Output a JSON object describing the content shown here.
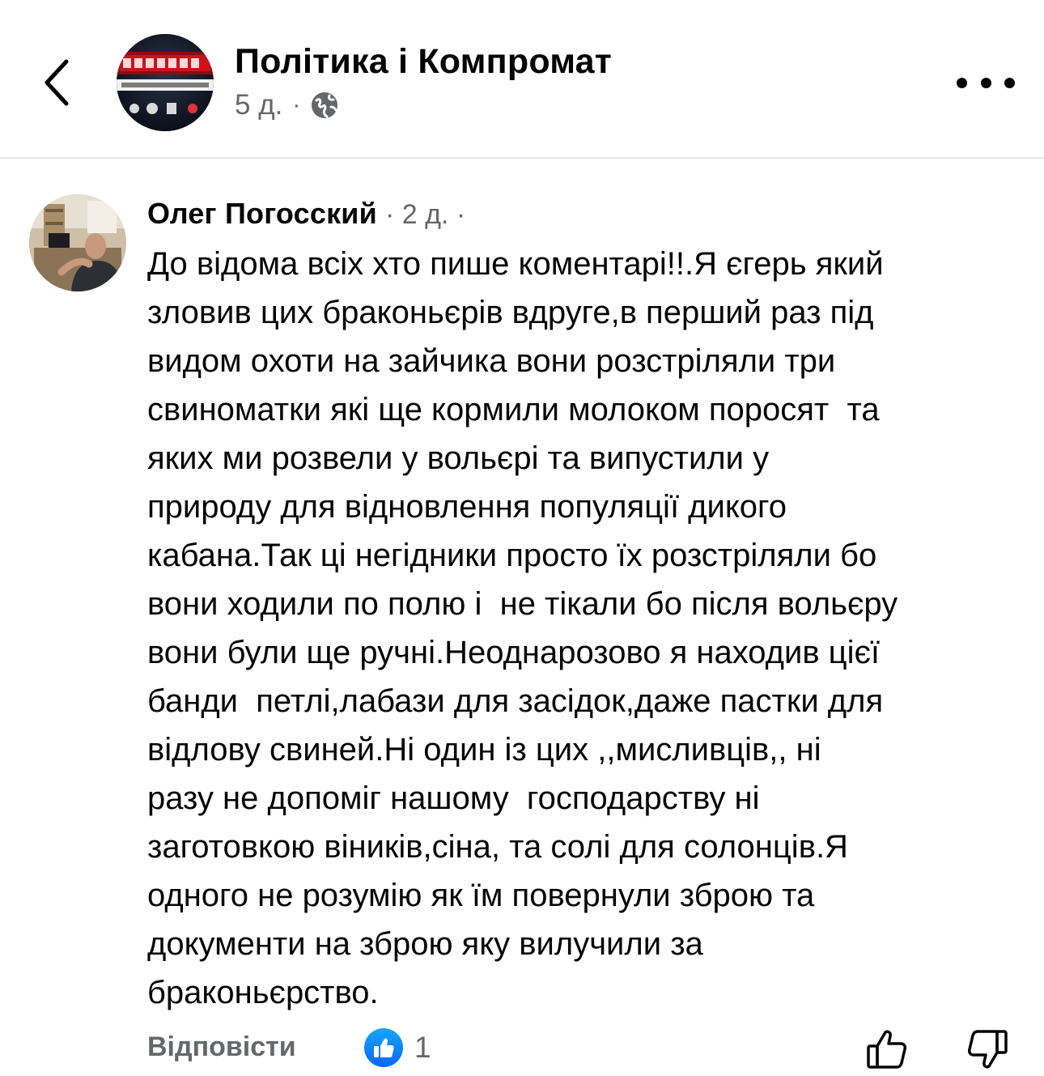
{
  "header": {
    "page_name": "Політика і Компромат",
    "time": "5 д.",
    "separator": "·",
    "audience_icon": "globe-icon",
    "back_icon": "chevron-left-icon",
    "more_icon": "more-horizontal-icon"
  },
  "comment": {
    "author": "Олег Погосский",
    "time": "· 2 д. ·",
    "lines": [
      "До відома всіх хто пише коментарі!!.Я єгерь який",
      "зловив цих браконьєрів вдруге,в перший раз під",
      "видом охоти на зайчика вони розстріляли три",
      "свиноматки які ще кормили молоком поросят  та",
      "яких ми розвели у вольєрі та випустили у",
      "природу для відновлення популяції дикого",
      "кабана.Так ці негідники просто їх розстріляли бо",
      "вони ходили по полю і  не тікали бо після вольєру",
      "вони були ще ручні.Неоднарозово я находив цієї",
      "банди  петлі,лабази для засідок,даже пастки для",
      "відлову свиней.Ні один із цих ,,мисливців,, ні",
      "разу не допоміг нашому  господарству ні",
      "заготовкою віників,сіна, та солі для солонців.Я",
      "одного не розумію як їм повернули зброю та",
      "документи на зброю яку вилучили за",
      "браконьєрство."
    ]
  },
  "actions": {
    "reply_label": "Відповісти",
    "reaction_icon": "like-reaction-icon",
    "reaction_count": "1",
    "upvote_icon": "thumb-up-icon",
    "downvote_icon": "thumb-down-icon"
  },
  "colors": {
    "primary_text": "#050505",
    "secondary_text": "#65676b",
    "like_blue": "#0866ff",
    "divider": "#e4e6eb"
  }
}
